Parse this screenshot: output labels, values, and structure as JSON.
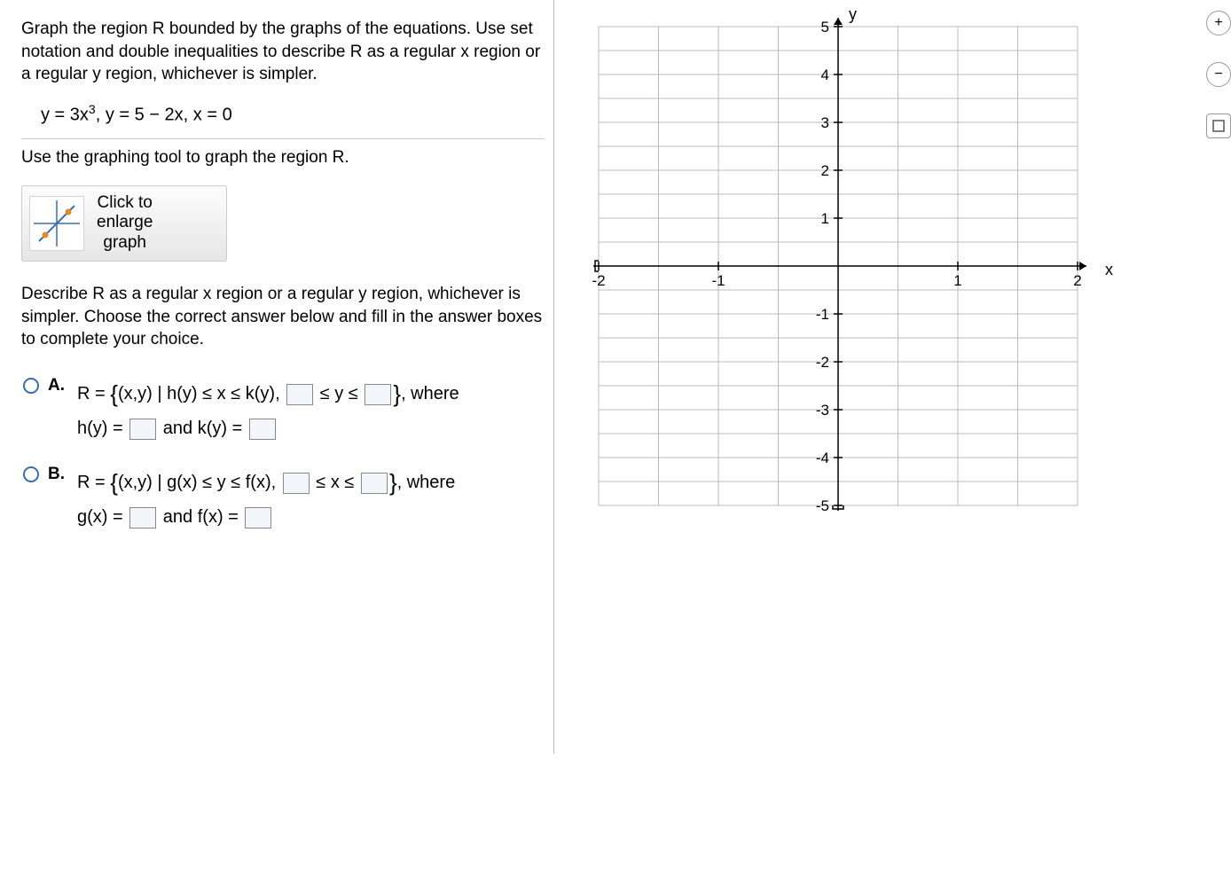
{
  "problem": "Graph the region R bounded by the graphs of the equations. Use set notation and double inequalities to describe R as a regular x region or a regular y region, whichever is simpler.",
  "equation_text": "y = 3x³, y = 5 − 2x, x = 0",
  "instruction": "Use the graphing tool to graph the region R.",
  "graph_button": {
    "line1": "Click to",
    "line2": "enlarge",
    "line3": "graph"
  },
  "describe": "Describe R as a regular x region or a regular y region, whichever is simpler. Choose the correct answer below and fill in the answer boxes to complete your choice.",
  "choices": {
    "A": {
      "label": "A.",
      "prefix": "R = ",
      "set_left": "(x,y) | h(y) ≤ x ≤ k(y),",
      "ineq": " ≤ y ≤ ",
      "where": ", where",
      "line2a": "h(y) = ",
      "line2b": " and k(y) = "
    },
    "B": {
      "label": "B.",
      "prefix": "R = ",
      "set_left": "(x,y) | g(x) ≤ y ≤ f(x),",
      "ineq": " ≤ x ≤ ",
      "where": ", where",
      "line2a": "g(x) = ",
      "line2b": " and f(x) = "
    }
  },
  "chart_data": {
    "type": "scatter",
    "title": "",
    "xlabel": "x",
    "ylabel": "y",
    "xlim": [
      -2,
      2
    ],
    "ylim": [
      -5,
      5
    ],
    "xticks": [
      -2,
      -1,
      1,
      2
    ],
    "yticks": [
      5,
      4,
      3,
      2,
      1,
      -1,
      -2,
      -3,
      -4,
      -5
    ],
    "series": []
  },
  "axis": {
    "y": "y",
    "x": "x"
  }
}
